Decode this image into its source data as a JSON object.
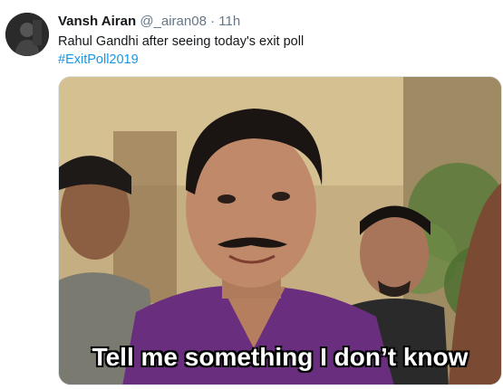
{
  "tweet": {
    "author_name": "Vansh Airan",
    "author_handle": "@_airan08",
    "separator": "·",
    "timestamp": "11h",
    "text": "Rahul Gandhi after seeing today's exit poll",
    "hashtag": "#ExitPoll2019",
    "media": {
      "caption": "Tell me something I don’t know"
    }
  },
  "colors": {
    "name": "#14171a",
    "secondary": "#657786",
    "link": "#1b95e0",
    "border": "#e1e8ed"
  }
}
